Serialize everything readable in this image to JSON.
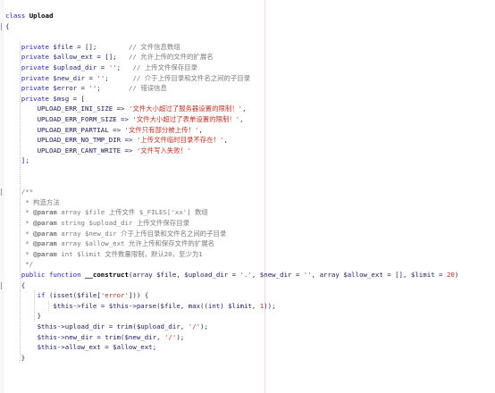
{
  "editor": {
    "lines": [
      {
        "seg": [
          [
            "kw",
            "class "
          ],
          [
            "cls",
            "Upload"
          ]
        ]
      },
      {
        "seg": [
          [
            "txt",
            "{"
          ]
        ]
      },
      {
        "seg": []
      },
      {
        "seg": [
          [
            "kw",
            "    private "
          ],
          [
            "var",
            "$file"
          ],
          [
            "txt",
            " = [];        "
          ],
          [
            "cmt",
            "// 文件信息数组"
          ]
        ]
      },
      {
        "seg": [
          [
            "kw",
            "    private "
          ],
          [
            "var",
            "$allow_ext"
          ],
          [
            "txt",
            " = [];   "
          ],
          [
            "cmt",
            "// 允许上传的文件的扩展名"
          ]
        ]
      },
      {
        "seg": [
          [
            "kw",
            "    private "
          ],
          [
            "var",
            "$upload_dir"
          ],
          [
            "txt",
            " = "
          ],
          [
            "str",
            "''"
          ],
          [
            "txt",
            ";   "
          ],
          [
            "cmt",
            "// 上传文件保存目录"
          ]
        ]
      },
      {
        "seg": [
          [
            "kw",
            "    private "
          ],
          [
            "var",
            "$new_dir"
          ],
          [
            "txt",
            " = "
          ],
          [
            "str",
            "''"
          ],
          [
            "txt",
            ";      "
          ],
          [
            "cmt",
            "// 介于上传目录和文件名之间的子目录"
          ]
        ]
      },
      {
        "seg": [
          [
            "kw",
            "    private "
          ],
          [
            "var",
            "$error"
          ],
          [
            "txt",
            " = "
          ],
          [
            "str",
            "''"
          ],
          [
            "txt",
            ";       "
          ],
          [
            "cmt",
            "// 错误信息"
          ]
        ]
      },
      {
        "seg": [
          [
            "kw",
            "    private "
          ],
          [
            "var",
            "$msg"
          ],
          [
            "txt",
            " = ["
          ]
        ]
      },
      {
        "seg": [
          [
            "txt",
            "        UPLOAD_ERR_INI_SIZE => "
          ],
          [
            "str",
            "'文件大小超过了服务器设置的限制！'"
          ],
          [
            "txt",
            ","
          ]
        ]
      },
      {
        "seg": [
          [
            "txt",
            "        UPLOAD_ERR_FORM_SIZE => "
          ],
          [
            "str",
            "'文件大小超过了表单设置的限制！'"
          ],
          [
            "txt",
            ","
          ]
        ]
      },
      {
        "seg": [
          [
            "txt",
            "        UPLOAD_ERR_PARTIAL => "
          ],
          [
            "str",
            "'文件只有部分被上传！'"
          ],
          [
            "txt",
            ","
          ]
        ]
      },
      {
        "seg": [
          [
            "txt",
            "        UPLOAD_ERR_NO_TMP_DIR => "
          ],
          [
            "str",
            "'上传文件临时目录不存在！'"
          ],
          [
            "txt",
            ","
          ]
        ]
      },
      {
        "seg": [
          [
            "txt",
            "        UPLOAD_ERR_CANT_WRITE => "
          ],
          [
            "str",
            "'文件写入失败！'"
          ]
        ]
      },
      {
        "seg": [
          [
            "txt",
            "    ];"
          ]
        ]
      },
      {
        "seg": []
      },
      {
        "seg": []
      },
      {
        "seg": [
          [
            "cmt",
            "    /**"
          ]
        ]
      },
      {
        "seg": [
          [
            "cmt",
            "     * 构造方法"
          ]
        ]
      },
      {
        "seg": [
          [
            "cmt",
            "     * "
          ],
          [
            "ann",
            "@param"
          ],
          [
            "cmt",
            " array $file 上传文件 $_FILES['xx'] 数组"
          ]
        ]
      },
      {
        "seg": [
          [
            "cmt",
            "     * "
          ],
          [
            "ann",
            "@param"
          ],
          [
            "cmt",
            " string $upload_dir 上传文件保存目录"
          ]
        ]
      },
      {
        "seg": [
          [
            "cmt",
            "     * "
          ],
          [
            "ann",
            "@param"
          ],
          [
            "cmt",
            " array $new_dir 介于上传目录和文件名之间的子目录"
          ]
        ]
      },
      {
        "seg": [
          [
            "cmt",
            "     * "
          ],
          [
            "ann",
            "@param"
          ],
          [
            "cmt",
            " array $allow_ext 允许上传和保存文件的扩展名"
          ]
        ]
      },
      {
        "seg": [
          [
            "cmt",
            "     * "
          ],
          [
            "ann",
            "@param"
          ],
          [
            "cmt",
            " int $limit 文件数量限制，默认20，至少为1"
          ]
        ]
      },
      {
        "seg": [
          [
            "cmt",
            "     */"
          ]
        ]
      },
      {
        "seg": [
          [
            "kw",
            "    public function "
          ],
          [
            "fn",
            "__construct"
          ],
          [
            "txt",
            "(array $file, $upload_dir = "
          ],
          [
            "str",
            "'.'"
          ],
          [
            "txt",
            ", $new_dir = "
          ],
          [
            "str",
            "''"
          ],
          [
            "txt",
            ", array $allow_ext = [], $limit = "
          ],
          [
            "num",
            "20"
          ],
          [
            "txt",
            ")"
          ]
        ]
      },
      {
        "seg": [
          [
            "txt",
            "    {"
          ]
        ]
      },
      {
        "seg": [
          [
            "kw",
            "        if "
          ],
          [
            "txt",
            "(isset($file["
          ],
          [
            "str",
            "'error'"
          ],
          [
            "txt",
            "])) {"
          ]
        ]
      },
      {
        "seg": [
          [
            "txt",
            "            $this->file = $this->parse($file, max((int) $limit, "
          ],
          [
            "num",
            "1"
          ],
          [
            "txt",
            "));"
          ]
        ]
      },
      {
        "seg": [
          [
            "txt",
            "        }"
          ]
        ]
      },
      {
        "seg": [
          [
            "txt",
            "        $this->upload_dir = trim($upload_dir, "
          ],
          [
            "str",
            "'/'"
          ],
          [
            "txt",
            ");"
          ]
        ]
      },
      {
        "seg": [
          [
            "txt",
            "        $this->new_dir = trim($new_dir, "
          ],
          [
            "str",
            "'/'"
          ],
          [
            "txt",
            ");"
          ]
        ]
      },
      {
        "seg": [
          [
            "txt",
            "        $this->allow_ext = $allow_ext;"
          ]
        ]
      },
      {
        "seg": [
          [
            "txt",
            "    }"
          ]
        ]
      }
    ]
  }
}
